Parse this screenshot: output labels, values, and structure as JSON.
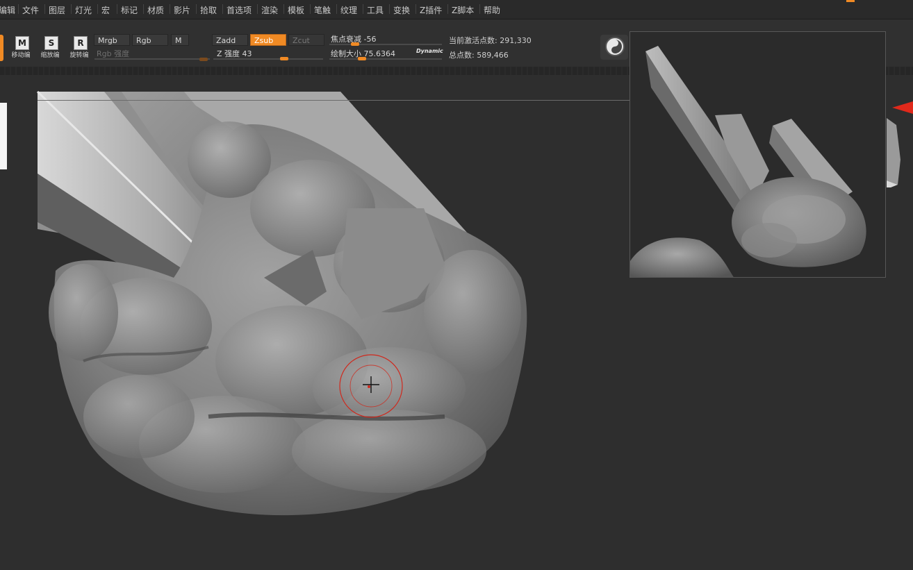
{
  "menu": {
    "items": [
      "编辑",
      "文件",
      "图层",
      "灯光",
      "宏",
      "标记",
      "材质",
      "影片",
      "拾取",
      "首选项",
      "渲染",
      "模板",
      "笔触",
      "纹理",
      "工具",
      "变换",
      "Z插件",
      "Z脚本",
      "帮助"
    ]
  },
  "toolbar": {
    "transform_buttons": [
      {
        "glyph": "M",
        "label": "移动编"
      },
      {
        "glyph": "S",
        "label": "缩放编"
      },
      {
        "glyph": "R",
        "label": "旋转编"
      }
    ],
    "color_mode": {
      "mrgb": "Mrgb",
      "rgb": "Rgb",
      "m": "M",
      "rgb_intensity_label": "Rgb 强度"
    },
    "sculpt_mode": {
      "zadd": "Zadd",
      "zsub": "Zsub",
      "zcut": "Zcut",
      "active": "Zsub",
      "z_intensity_label": "Z 强度",
      "z_intensity_value": "43"
    },
    "brush": {
      "focal_shift_label": "焦点衰减",
      "focal_shift_value": "-56",
      "draw_size_label": "绘制大小",
      "draw_size_value": "75.6364",
      "dynamic_label": "Dynamic"
    },
    "stats": {
      "active_points_label": "当前激活点数:",
      "active_points_value": "291,330",
      "total_points_label": "总点数:",
      "total_points_value": "589,466"
    }
  },
  "colors": {
    "accent": "#f08a24",
    "cursor_ring": "#d0281c",
    "marker": "#e0291b"
  },
  "icons": {
    "lightbox": "lightbox-icon",
    "brush_cursor": "crosshair-icon"
  }
}
